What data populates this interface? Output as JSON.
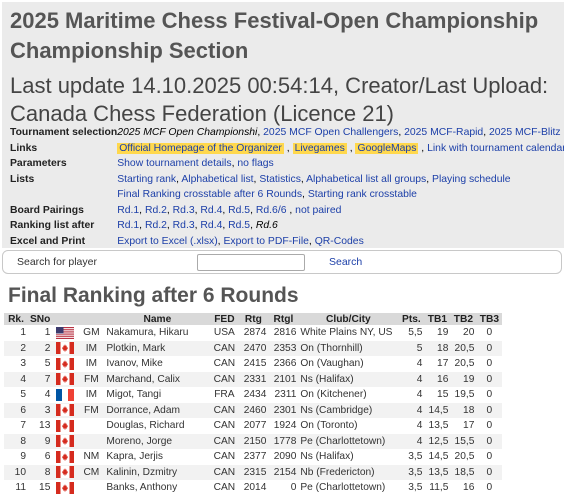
{
  "header": {
    "event_title": "2025 Maritime Chess Festival-Open Championship Championship Section",
    "last_update": "Last update 14.10.2025 00:54:14, Creator/Last Upload: Canada Chess Federation (Licence 21)"
  },
  "info": {
    "tournament_selection_label": "Tournament selection",
    "t_current": "2025 MCF Open Championshi",
    "t_sep1": ", ",
    "t_challengers": "2025 MCF Open Challengers",
    "t_sep2": ", ",
    "t_rapid": "2025 MCF-Rapid",
    "t_sep3": ", ",
    "t_blitz": "2025 MCF-Blitz",
    "links_label": "Links",
    "link_homepage": "Official Homepage of the Organizer",
    "link_sep1": " , ",
    "link_livegames": "Livegames",
    "link_sep2": " , ",
    "link_googlemaps": "GoogleMaps",
    "link_sep3": " , ",
    "link_calendar": "Link with tournament calendar",
    "parameters_label": "Parameters",
    "param_details": "Show tournament details",
    "param_sep": ", ",
    "param_flags": "no flags",
    "lists_label": "Lists",
    "list_starting": "Starting rank",
    "list_sep1": ", ",
    "list_alpha": "Alphabetical list",
    "list_sep2": ", ",
    "list_stats": "Statistics",
    "list_sep3": ", ",
    "list_alpha_all": "Alphabetical list all groups",
    "list_sep4": ", ",
    "list_schedule": "Playing schedule",
    "list_final_crosstable": "Final Ranking crosstable after 6 Rounds",
    "list_sep5": ", ",
    "list_start_crosstable": "Starting rank crosstable",
    "pairings_label": "Board Pairings",
    "pair_rd1": "Rd.1",
    "pair_rd2": "Rd.2",
    "pair_rd3": "Rd.3",
    "pair_rd4": "Rd.4",
    "pair_rd5": "Rd.5",
    "pair_rd6": "Rd.6/6",
    "pair_not_paired": "not paired",
    "pair_sep": ", ",
    "pair_sep_last": " , ",
    "ranking_after_label": "Ranking list after",
    "rank_rd1": "Rd.1",
    "rank_rd2": "Rd.2",
    "rank_rd3": "Rd.3",
    "rank_rd4": "Rd.4",
    "rank_rd5": "Rd.5",
    "rank_rd6": "Rd.6",
    "rank_sep": ", ",
    "excel_label": "Excel and Print",
    "export_excel": "Export to Excel (.xlsx)",
    "export_sep1": ", ",
    "export_pdf": "Export to PDF-File",
    "export_sep2": ", ",
    "export_qr": "QR-Codes"
  },
  "search": {
    "label": "Search for player",
    "placeholder": "",
    "button": "Search"
  },
  "ranking": {
    "title": "Final Ranking after 6 Rounds",
    "columns": {
      "rk": "Rk.",
      "sno": "SNo",
      "title": "",
      "name": "Name",
      "fed": "FED",
      "rtg": "Rtg",
      "rtgl": "Rtgl",
      "club": "Club/City",
      "pts": "Pts.",
      "tb1": "TB1",
      "tb2": "TB2",
      "tb3": "TB3"
    },
    "rows": [
      {
        "rk": "1",
        "sno": "1",
        "flag": "usa-flag-icon",
        "title": "GM",
        "name": "Nakamura, Hikaru",
        "fed": "USA",
        "rtg": "2874",
        "rtgl": "2816",
        "club": "White Plains NY, US",
        "pts": "5,5",
        "tb1": "19",
        "tb2": "20",
        "tb3": "0"
      },
      {
        "rk": "2",
        "sno": "2",
        "flag": "canada-flag-icon",
        "title": "IM",
        "name": "Plotkin, Mark",
        "fed": "CAN",
        "rtg": "2470",
        "rtgl": "2353",
        "club": "On (Thornhill)",
        "pts": "5",
        "tb1": "18",
        "tb2": "20,5",
        "tb3": "0"
      },
      {
        "rk": "3",
        "sno": "5",
        "flag": "canada-flag-icon",
        "title": "IM",
        "name": "Ivanov, Mike",
        "fed": "CAN",
        "rtg": "2415",
        "rtgl": "2366",
        "club": "On (Vaughan)",
        "pts": "4",
        "tb1": "17",
        "tb2": "20,5",
        "tb3": "0"
      },
      {
        "rk": "4",
        "sno": "7",
        "flag": "canada-flag-icon",
        "title": "FM",
        "name": "Marchand, Calix",
        "fed": "CAN",
        "rtg": "2331",
        "rtgl": "2101",
        "club": "Ns (Halifax)",
        "pts": "4",
        "tb1": "16",
        "tb2": "19",
        "tb3": "0"
      },
      {
        "rk": "5",
        "sno": "4",
        "flag": "france-flag-icon",
        "title": "IM",
        "name": "Migot, Tangi",
        "fed": "FRA",
        "rtg": "2434",
        "rtgl": "2311",
        "club": "On (Kitchener)",
        "pts": "4",
        "tb1": "15",
        "tb2": "19,5",
        "tb3": "0"
      },
      {
        "rk": "6",
        "sno": "3",
        "flag": "canada-flag-icon",
        "title": "FM",
        "name": "Dorrance, Adam",
        "fed": "CAN",
        "rtg": "2460",
        "rtgl": "2301",
        "club": "Ns (Cambridge)",
        "pts": "4",
        "tb1": "14,5",
        "tb2": "18",
        "tb3": "0"
      },
      {
        "rk": "7",
        "sno": "13",
        "flag": "canada-flag-icon",
        "title": "",
        "name": "Douglas, Richard",
        "fed": "CAN",
        "rtg": "2077",
        "rtgl": "1924",
        "club": "On (Toronto)",
        "pts": "4",
        "tb1": "13,5",
        "tb2": "17",
        "tb3": "0"
      },
      {
        "rk": "8",
        "sno": "9",
        "flag": "canada-flag-icon",
        "title": "",
        "name": "Moreno, Jorge",
        "fed": "CAN",
        "rtg": "2150",
        "rtgl": "1778",
        "club": "Pe (Charlottetown)",
        "pts": "4",
        "tb1": "12,5",
        "tb2": "15,5",
        "tb3": "0"
      },
      {
        "rk": "9",
        "sno": "6",
        "flag": "canada-flag-icon",
        "title": "NM",
        "name": "Kapra, Jerjis",
        "fed": "CAN",
        "rtg": "2377",
        "rtgl": "2090",
        "club": "Ns (Halifax)",
        "pts": "3,5",
        "tb1": "14,5",
        "tb2": "20,5",
        "tb3": "0"
      },
      {
        "rk": "10",
        "sno": "8",
        "flag": "canada-flag-icon",
        "title": "CM",
        "name": "Kalinin, Dzmitry",
        "fed": "CAN",
        "rtg": "2315",
        "rtgl": "2154",
        "club": "Nb (Fredericton)",
        "pts": "3,5",
        "tb1": "13,5",
        "tb2": "18,5",
        "tb3": "0"
      },
      {
        "rk": "11",
        "sno": "15",
        "flag": "canada-flag-icon",
        "title": "",
        "name": "Banks, Anthony",
        "fed": "CAN",
        "rtg": "2014",
        "rtgl": "0",
        "club": "Pe (Charlottetown)",
        "pts": "3,5",
        "tb1": "11,5",
        "tb2": "16",
        "tb3": "0"
      }
    ]
  },
  "colors": {
    "header_bg": "#ebebeb",
    "link": "#1c3fa8",
    "highlight": "#ffd84d",
    "table_header_bg": "#d9d9d9",
    "row_alt_bg": "#f2f2f2"
  }
}
